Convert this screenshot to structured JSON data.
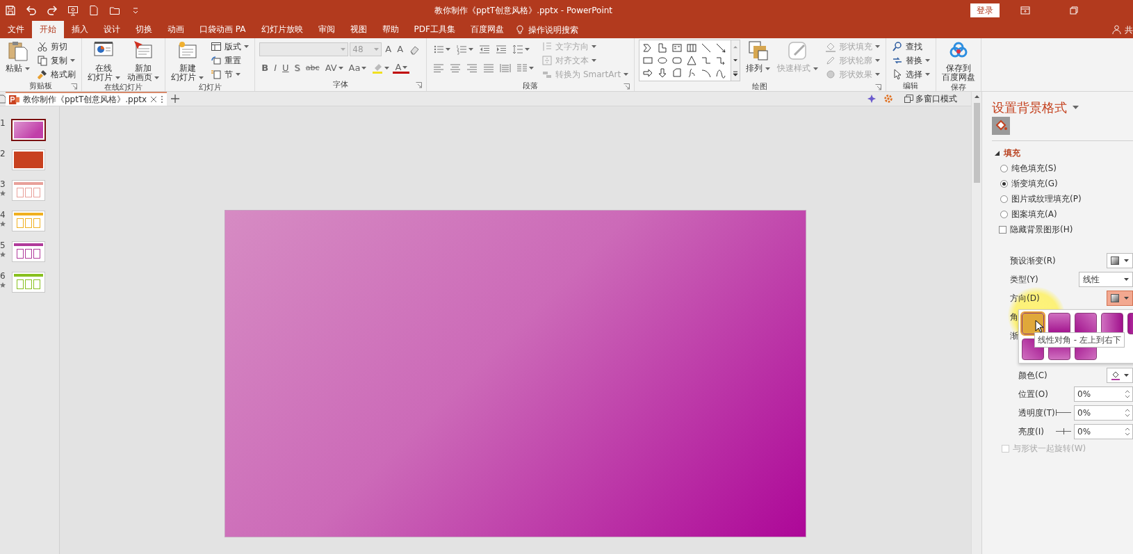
{
  "title_bar": {
    "title": "教你制作《pptT创意风格》.pptx  -  PowerPoint",
    "login": "登录"
  },
  "menu_tabs": [
    {
      "label": "文件",
      "selected": false
    },
    {
      "label": "开始",
      "selected": true
    },
    {
      "label": "插入",
      "selected": false
    },
    {
      "label": "设计",
      "selected": false
    },
    {
      "label": "切换",
      "selected": false
    },
    {
      "label": "动画",
      "selected": false
    },
    {
      "label": "口袋动画 PA",
      "selected": false
    },
    {
      "label": "幻灯片放映",
      "selected": false
    },
    {
      "label": "审阅",
      "selected": false
    },
    {
      "label": "视图",
      "selected": false
    },
    {
      "label": "帮助",
      "selected": false
    },
    {
      "label": "PDF工具集",
      "selected": false
    },
    {
      "label": "百度网盘",
      "selected": false
    }
  ],
  "tell_me": "操作说明搜索",
  "share": "共",
  "ribbon": [
    {
      "name": "剪贴板",
      "launcher": true,
      "items": [
        {
          "kind": "large",
          "lines": [
            "粘贴"
          ],
          "dropdown": true,
          "disabled": false
        },
        {
          "kind": "stack",
          "items": [
            {
              "label": "剪切",
              "dropdown": false,
              "disabled": false
            },
            {
              "label": "复制",
              "dropdown": true,
              "disabled": false
            },
            {
              "label": "格式刷",
              "dropdown": false,
              "disabled": false
            }
          ]
        }
      ]
    },
    {
      "name": "在线幻灯片",
      "launcher": false,
      "items": [
        {
          "kind": "large",
          "lines": [
            "在线",
            "幻灯片"
          ],
          "dropdown": true,
          "disabled": false
        },
        {
          "kind": "large",
          "lines": [
            "新加",
            "动画页"
          ],
          "dropdown": true,
          "disabled": false
        }
      ]
    },
    {
      "name": "幻灯片",
      "launcher": false,
      "items": [
        {
          "kind": "large",
          "lines": [
            "新建",
            "幻灯片"
          ],
          "dropdown": true,
          "disabled": false
        },
        {
          "kind": "stack",
          "items": [
            {
              "label": "版式",
              "dropdown": true,
              "disabled": false
            },
            {
              "label": "重置",
              "dropdown": false,
              "disabled": false
            },
            {
              "label": "节",
              "dropdown": true,
              "disabled": false
            }
          ]
        }
      ]
    },
    {
      "name": "字体",
      "launcher": true,
      "items": [
        {
          "kind": "font",
          "font_size": "48",
          "row1": [
            {
              "kind": "glyph",
              "text": "A",
              "dropdown": false
            },
            {
              "kind": "glyph",
              "text": "A",
              "dropdown": false
            },
            {
              "kind": "icon",
              "dropdown": false
            }
          ],
          "row2": [
            {
              "kind": "glyph",
              "text": "B",
              "dropdown": false
            },
            {
              "kind": "glyph",
              "text": "I",
              "dropdown": false
            },
            {
              "kind": "glyph",
              "text": "U",
              "dropdown": false
            },
            {
              "kind": "glyph",
              "text": "S",
              "dropdown": false
            },
            {
              "kind": "glyph",
              "text": "abc",
              "dropdown": false
            },
            {
              "kind": "glyph",
              "text": "AV",
              "dropdown": true
            },
            {
              "kind": "glyph",
              "text": "Aa",
              "dropdown": true
            },
            {
              "kind": "icon",
              "dropdown": true
            },
            {
              "kind": "glyph",
              "text": "A",
              "dropdown": true
            }
          ]
        }
      ]
    },
    {
      "name": "段落",
      "launcher": true,
      "items": [
        {
          "kind": "icons",
          "rows": [
            [
              {
                "dropdown": true
              },
              {
                "dropdown": true
              },
              {
                "dropdown": false
              },
              {
                "dropdown": false
              },
              {
                "dropdown": true
              }
            ],
            [
              {
                "dropdown": false
              },
              {
                "dropdown": false
              },
              {
                "dropdown": false
              },
              {
                "dropdown": false
              },
              {
                "dropdown": false
              },
              {
                "dropdown": true
              }
            ]
          ]
        },
        {
          "kind": "stack",
          "items": [
            {
              "label": "文字方向",
              "dropdown": true,
              "disabled": true
            },
            {
              "label": "对齐文本",
              "dropdown": true,
              "disabled": true
            },
            {
              "label": "转换为 SmartArt",
              "dropdown": true,
              "disabled": true
            }
          ]
        }
      ]
    },
    {
      "name": "绘图",
      "launcher": true,
      "items": [
        {
          "kind": "gallery"
        },
        {
          "kind": "large",
          "lines": [
            "排列"
          ],
          "dropdown": true,
          "disabled": false
        },
        {
          "kind": "large",
          "lines": [
            "快速样式"
          ],
          "dropdown": true,
          "disabled": true
        },
        {
          "kind": "stack",
          "items": [
            {
              "label": "形状填充",
              "dropdown": true,
              "disabled": true
            },
            {
              "label": "形状轮廓",
              "dropdown": true,
              "disabled": true
            },
            {
              "label": "形状效果",
              "dropdown": true,
              "disabled": true
            }
          ]
        }
      ]
    },
    {
      "name": "编辑",
      "launcher": false,
      "items": [
        {
          "kind": "stack",
          "items": [
            {
              "label": "查找",
              "dropdown": false,
              "disabled": false
            },
            {
              "label": "替换",
              "dropdown": true,
              "disabled": false
            },
            {
              "label": "选择",
              "dropdown": true,
              "disabled": false
            }
          ]
        }
      ]
    },
    {
      "name": "保存",
      "launcher": false,
      "items": [
        {
          "kind": "large",
          "lines": [
            "保存到",
            "百度网盘"
          ],
          "dropdown": false,
          "disabled": false
        }
      ]
    }
  ],
  "document_tabs": [
    {
      "label": "教你制作《pptT创意风格》.pptx",
      "selected": true
    }
  ],
  "window_mode": "多窗口模式",
  "slides": [
    {
      "number": "1",
      "selected": true,
      "animated": false,
      "kind": "gradient",
      "color": "#c13fa9"
    },
    {
      "number": "2",
      "selected": false,
      "animated": false,
      "kind": "title",
      "color": "#c8411f"
    },
    {
      "number": "3",
      "selected": false,
      "animated": true,
      "kind": "content",
      "color": "#e8a09a"
    },
    {
      "number": "4",
      "selected": false,
      "animated": true,
      "kind": "content",
      "color": "#f0b020"
    },
    {
      "number": "5",
      "selected": false,
      "animated": true,
      "kind": "content",
      "color": "#b03a9a"
    },
    {
      "number": "6",
      "selected": false,
      "animated": true,
      "kind": "content",
      "color": "#88c020"
    }
  ],
  "format_pane": {
    "title": "设置背景格式",
    "section": {
      "label": "填充",
      "expanded": true
    },
    "fill_options": [
      {
        "label": "纯色填充(S)",
        "selected": false
      },
      {
        "label": "渐变填充(G)",
        "selected": true
      },
      {
        "label": "图片或纹理填充(P)",
        "selected": false
      },
      {
        "label": "图案填充(A)",
        "selected": false
      }
    ],
    "hide_background": {
      "label": "隐藏背景图形(H)",
      "checked": false
    },
    "preset_gradient": {
      "label": "预设渐变(R)"
    },
    "type": {
      "label": "类型(Y)",
      "value": "线性"
    },
    "direction": {
      "label": "方向(D)",
      "open": true
    },
    "angle": {
      "label": "角"
    },
    "gradient_stops": {
      "label": "渐"
    },
    "color": {
      "label": "颜色(C)"
    },
    "position": {
      "label": "位置(O)",
      "value": "0%"
    },
    "transparency": {
      "label": "透明度(T)",
      "value": "0%",
      "level": 0
    },
    "brightness": {
      "label": "亮度(I)",
      "value": "0%",
      "level": 0.5
    },
    "rotate_with_shape": {
      "label": "与形状一起旋转(W)",
      "checked": false,
      "disabled": true
    }
  },
  "direction_gallery": {
    "swatches": [
      {
        "selected": true
      },
      {
        "selected": false
      },
      {
        "selected": false
      },
      {
        "selected": false
      },
      {
        "selected": false
      },
      {
        "selected": false
      },
      {
        "selected": false
      },
      {
        "selected": false
      }
    ],
    "tooltip": "线性对角 - 左上到右下"
  }
}
